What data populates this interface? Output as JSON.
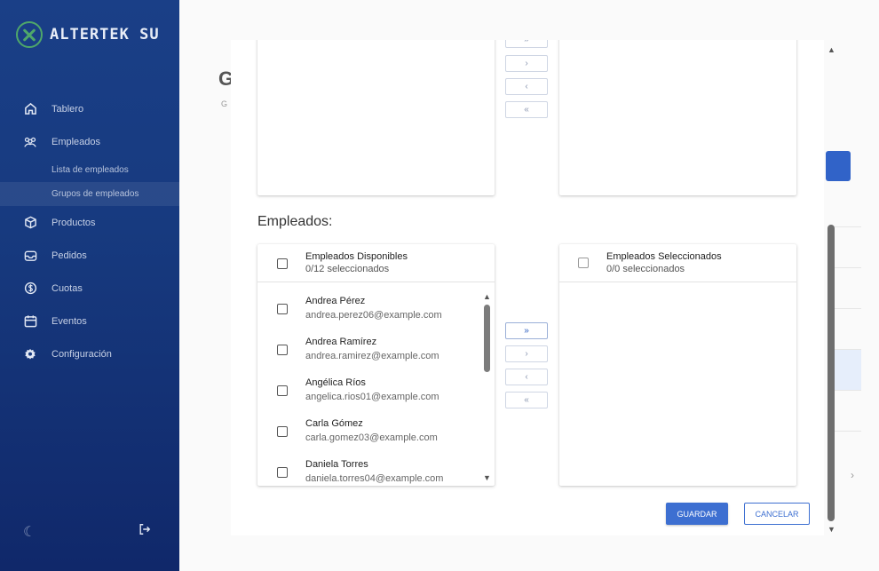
{
  "brand": {
    "name": "ALTERTEK SU"
  },
  "sidebar": {
    "items": [
      {
        "label": "Tablero",
        "icon": "home-icon"
      },
      {
        "label": "Empleados",
        "icon": "people-icon"
      },
      {
        "label": "Productos",
        "icon": "cube-icon"
      },
      {
        "label": "Pedidos",
        "icon": "inbox-icon"
      },
      {
        "label": "Cuotas",
        "icon": "coin-icon"
      },
      {
        "label": "Eventos",
        "icon": "calendar-icon"
      },
      {
        "label": "Configuración",
        "icon": "gear-icon"
      }
    ],
    "subitems": [
      {
        "label": "Lista de empleados"
      },
      {
        "label": "Grupos de empleados",
        "active": true
      }
    ]
  },
  "background_page": {
    "title": "G",
    "subtitle": "G"
  },
  "dialog": {
    "transfer_buttons": {
      "move_all_right": "»",
      "move_right": "›",
      "move_left": "‹",
      "move_all_left": "«"
    },
    "employees_section_label": "Empleados:",
    "available": {
      "title": "Empleados Disponibles",
      "count": "0/12 seleccionados",
      "items": [
        {
          "name": "Andrea Pérez",
          "email": "andrea.perez06@example.com"
        },
        {
          "name": "Andrea Ramírez",
          "email": "andrea.ramirez@example.com"
        },
        {
          "name": "Angélica Ríos",
          "email": "angelica.rios01@example.com"
        },
        {
          "name": "Carla Gómez",
          "email": "carla.gomez03@example.com"
        },
        {
          "name": "Daniela Torres",
          "email": "daniela.torres04@example.com"
        }
      ]
    },
    "selected": {
      "title": "Empleados Seleccionados",
      "count": "0/0 seleccionados"
    },
    "save_label": "GUARDAR",
    "cancel_label": "CANCELAR"
  },
  "colors": {
    "sidebar": "#173a7f",
    "primary": "#3d6fd1",
    "brand_green": "#4fa76a"
  }
}
